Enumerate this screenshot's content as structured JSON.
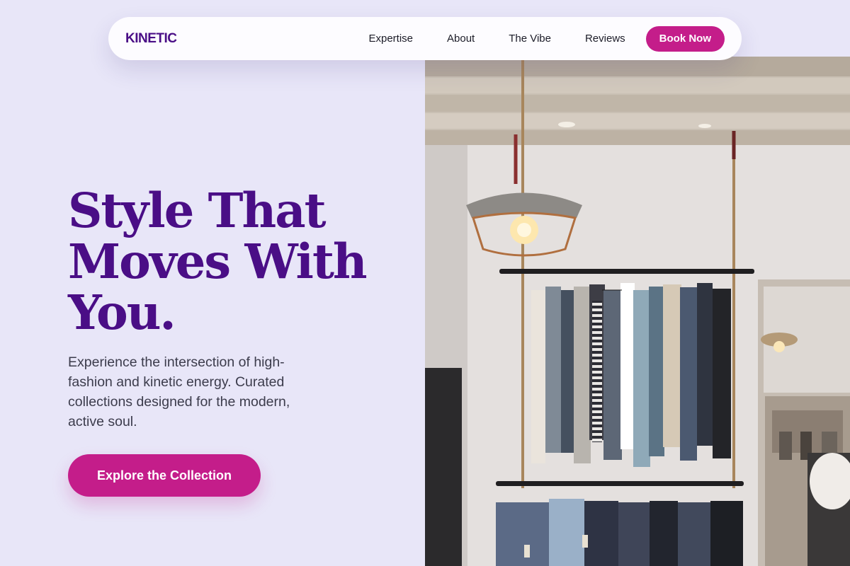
{
  "nav": {
    "logo": "KINETIC",
    "links": [
      "Expertise",
      "About",
      "The Vibe",
      "Reviews"
    ],
    "cta": "Book Now"
  },
  "hero": {
    "title": "Style That Moves With You.",
    "subtitle": "Experience the intersection of high-fashion and kinetic energy. Curated collections designed for the modern, active soul.",
    "cta": "Explore the Collection"
  },
  "image": {
    "alt": "Clothing boutique interior with hanging rails and industrial pendant lamp"
  },
  "colors": {
    "brand": "#4a0e86",
    "accent": "#c41d8a",
    "background": "#e8e6f8"
  }
}
